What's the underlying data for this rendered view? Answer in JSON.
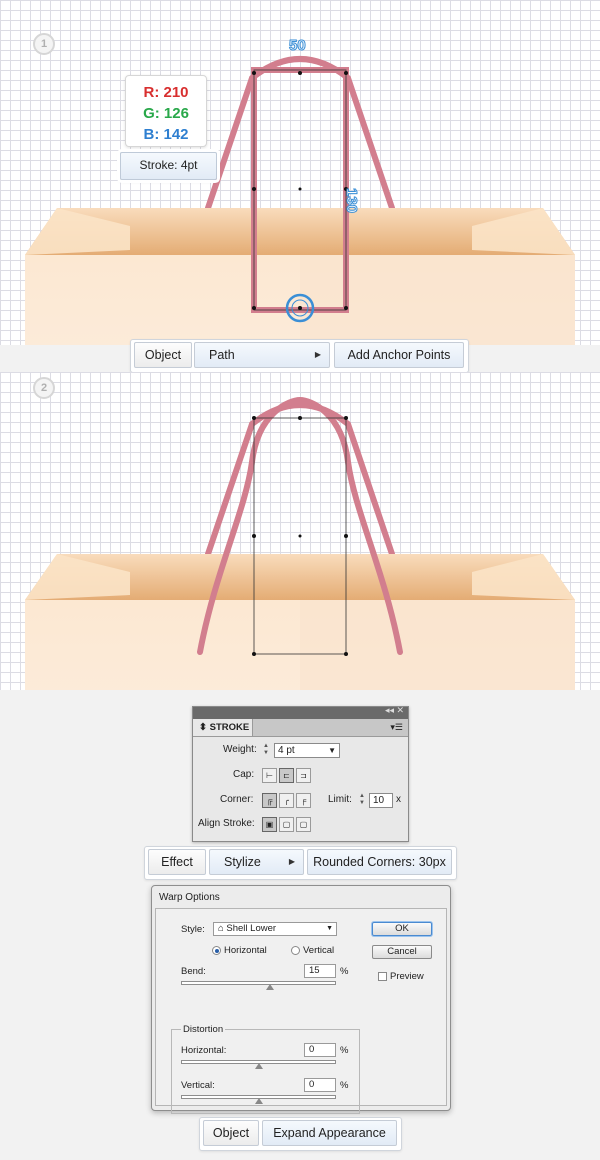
{
  "step1": {
    "badge": "1",
    "color": {
      "r": "R: 210",
      "g": "G: 126",
      "b": "B: 142"
    },
    "stroke_label": "Stroke: 4pt",
    "dim_width": "50",
    "dim_height": "130",
    "menu": {
      "object": "Object",
      "path": "Path",
      "add_anchor": "Add Anchor Points"
    }
  },
  "step2": {
    "badge": "2"
  },
  "stroke_panel": {
    "tab": "STROKE",
    "weight_label": "Weight:",
    "weight_value": "4 pt",
    "cap_label": "Cap:",
    "corner_label": "Corner:",
    "limit_label": "Limit:",
    "limit_value": "10",
    "limit_unit": "x",
    "align_label": "Align Stroke:"
  },
  "menu2": {
    "effect": "Effect",
    "stylize": "Stylize",
    "rounded": "Rounded Corners: 30px"
  },
  "warp": {
    "title": "Warp Options",
    "style_label": "Style:",
    "style_value": "Shell Lower",
    "horizontal": "Horizontal",
    "vertical": "Vertical",
    "bend_label": "Bend:",
    "bend_value": "15",
    "pct": "%",
    "distortion_label": "Distortion",
    "dist_h_label": "Horizontal:",
    "dist_h_value": "0",
    "dist_v_label": "Vertical:",
    "dist_v_value": "0",
    "ok": "OK",
    "cancel": "Cancel",
    "preview": "Preview",
    "bend_fraction": 0.575,
    "dist_h_fraction": 0.5,
    "dist_v_fraction": 0.5
  },
  "menu3": {
    "object": "Object",
    "expand": "Expand Appearance"
  },
  "colors": {
    "handle_stroke": "#d27e8e",
    "bag_light": "#fbe9d6",
    "bag_dark": "#e8b47e"
  }
}
